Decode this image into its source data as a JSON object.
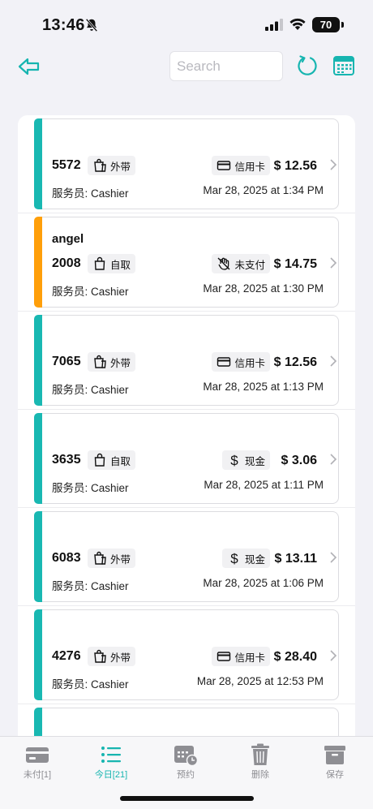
{
  "status": {
    "time": "13:46",
    "battery": "70"
  },
  "nav": {
    "search_placeholder": "Search"
  },
  "colors": {
    "accent": "#17b5b0",
    "paid": "#19b8b2",
    "unpaid": "#ff9f0a"
  },
  "orders": [
    {
      "customer": "",
      "number": "5572",
      "type_label": "外带",
      "type_icon": "takeout-bag-icon",
      "payment_label": "信用卡",
      "payment_icon": "credit-card-icon",
      "amount": "$ 12.56",
      "server": "服务员: Cashier",
      "datetime": "Mar 28, 2025 at 1:34 PM",
      "status": "paid"
    },
    {
      "customer": "angel",
      "number": "2008",
      "type_label": "自取",
      "type_icon": "pickup-bag-icon",
      "payment_label": "未支付",
      "payment_icon": "no-payment-icon",
      "amount": "$ 14.75",
      "server": "服务员: Cashier",
      "datetime": "Mar 28, 2025 at 1:30 PM",
      "status": "unpaid"
    },
    {
      "customer": "",
      "number": "7065",
      "type_label": "外带",
      "type_icon": "takeout-bag-icon",
      "payment_label": "信用卡",
      "payment_icon": "credit-card-icon",
      "amount": "$ 12.56",
      "server": "服务员: Cashier",
      "datetime": "Mar 28, 2025 at 1:13 PM",
      "status": "paid"
    },
    {
      "customer": "",
      "number": "3635",
      "type_label": "自取",
      "type_icon": "pickup-bag-icon",
      "payment_label": "现金",
      "payment_icon": "dollar-icon",
      "amount": "$ 3.06",
      "server": "服务员: Cashier",
      "datetime": "Mar 28, 2025 at 1:11 PM",
      "status": "paid"
    },
    {
      "customer": "",
      "number": "6083",
      "type_label": "外带",
      "type_icon": "takeout-bag-icon",
      "payment_label": "现金",
      "payment_icon": "dollar-icon",
      "amount": "$ 13.11",
      "server": "服务员: Cashier",
      "datetime": "Mar 28, 2025 at 1:06 PM",
      "status": "paid"
    },
    {
      "customer": "",
      "number": "4276",
      "type_label": "外带",
      "type_icon": "takeout-bag-icon",
      "payment_label": "信用卡",
      "payment_icon": "credit-card-icon",
      "amount": "$ 28.40",
      "server": "服务员: Cashier",
      "datetime": "Mar 28, 2025 at 12:53 PM",
      "status": "paid"
    }
  ],
  "tabs": [
    {
      "label": "未付[1]",
      "icon": "card-icon",
      "active": false
    },
    {
      "label": "今日[21]",
      "icon": "list-icon",
      "active": true
    },
    {
      "label": "预约",
      "icon": "calendar-clock-icon",
      "active": false
    },
    {
      "label": "删除",
      "icon": "trash-icon",
      "active": false
    },
    {
      "label": "保存",
      "icon": "archive-icon",
      "active": false
    }
  ]
}
